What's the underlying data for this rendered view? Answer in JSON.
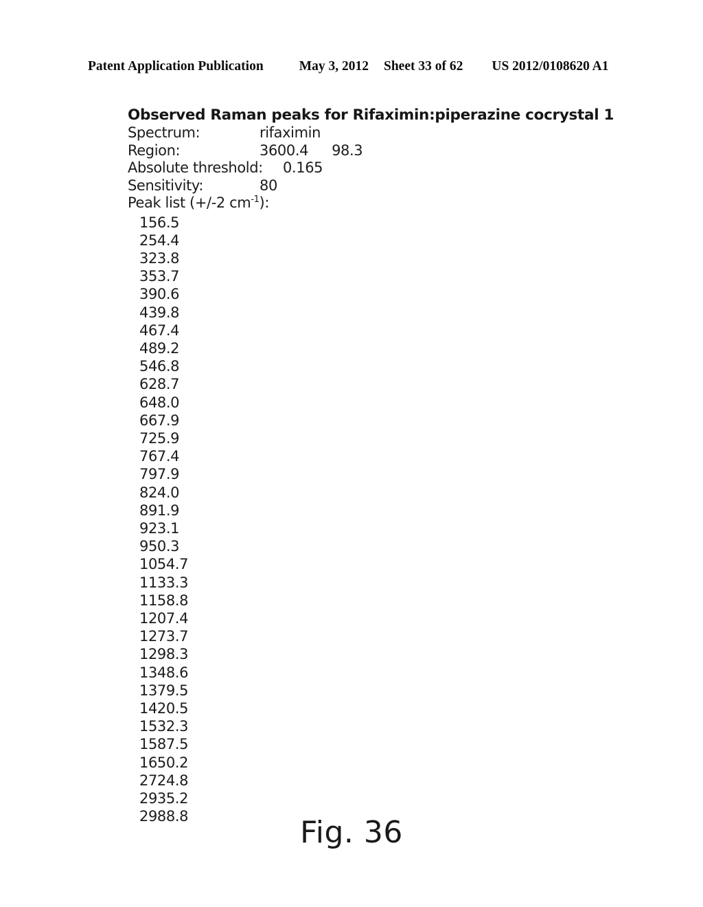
{
  "header": {
    "publication": "Patent Application Publication",
    "date": "May 3, 2012",
    "sheet": "Sheet 33 of 62",
    "number": "US 2012/0108620 A1"
  },
  "report": {
    "title": "Observed Raman peaks for Rifaximin:piperazine cocrystal 1",
    "spectrum_label": "Spectrum:",
    "spectrum_value": "rifaximin",
    "region_label": "Region:",
    "region_start": "3600.4",
    "region_end": "98.3",
    "threshold_label": "Absolute threshold:",
    "threshold_value": "0.165",
    "sensitivity_label": "Sensitivity:",
    "sensitivity_value": "80",
    "peak_list_label_prefix": "Peak list (+/-2 cm",
    "peak_list_label_sup": "-1",
    "peak_list_label_suffix": "):",
    "peaks": [
      "156.5",
      "254.4",
      "323.8",
      "353.7",
      "390.6",
      "439.8",
      "467.4",
      "489.2",
      "546.8",
      "628.7",
      "648.0",
      "667.9",
      "725.9",
      "767.4",
      "797.9",
      "824.0",
      "891.9",
      "923.1",
      "950.3",
      "1054.7",
      "1133.3",
      "1158.8",
      "1207.4",
      "1273.7",
      "1298.3",
      "1348.6",
      "1379.5",
      "1420.5",
      "1532.3",
      "1587.5",
      "1650.2",
      "2724.8",
      "2935.2",
      "2988.8"
    ]
  },
  "figure": {
    "caption": "Fig. 36"
  }
}
